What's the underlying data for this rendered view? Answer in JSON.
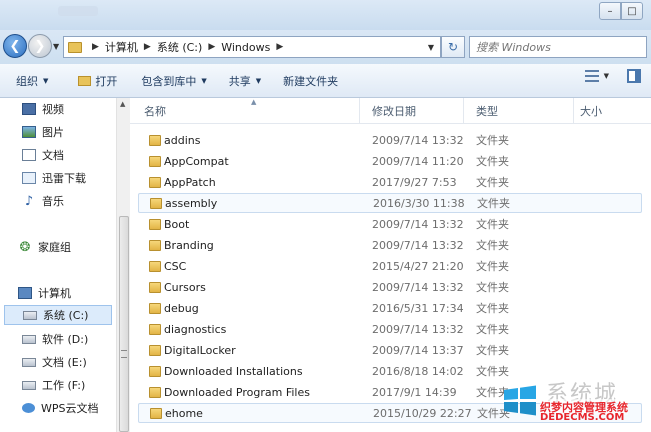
{
  "window": {
    "minimize_glyph": "–",
    "maximize_glyph": "□"
  },
  "address": {
    "breadcrumbs": [
      "计算机",
      "系统 (C:)",
      "Windows"
    ],
    "search_placeholder": "搜索 Windows"
  },
  "toolbar": {
    "organize": "组织",
    "open": "打开",
    "include_in_library": "包含到库中",
    "share": "共享",
    "new_folder": "新建文件夹"
  },
  "nav": {
    "items": [
      {
        "label": "视频",
        "icon": "video-icon"
      },
      {
        "label": "图片",
        "icon": "picture-icon"
      },
      {
        "label": "文档",
        "icon": "document-icon"
      },
      {
        "label": "迅雷下载",
        "icon": "download-folder-icon"
      },
      {
        "label": "音乐",
        "icon": "music-icon"
      },
      {
        "label": "家庭组",
        "icon": "homegroup-icon"
      },
      {
        "label": "计算机",
        "icon": "computer-icon"
      },
      {
        "label": "系统 (C:)",
        "icon": "drive-icon"
      },
      {
        "label": "软件 (D:)",
        "icon": "drive-icon"
      },
      {
        "label": "文档 (E:)",
        "icon": "drive-icon"
      },
      {
        "label": "工作 (F:)",
        "icon": "drive-icon"
      },
      {
        "label": "WPS云文档",
        "icon": "cloud-icon"
      }
    ]
  },
  "columns": {
    "name": "名称",
    "modified": "修改日期",
    "type": "类型",
    "size": "大小"
  },
  "files": [
    {
      "name": "addins",
      "date": "2009/7/14 13:32",
      "type": "文件夹"
    },
    {
      "name": "AppCompat",
      "date": "2009/7/14 11:20",
      "type": "文件夹"
    },
    {
      "name": "AppPatch",
      "date": "2017/9/27 7:53",
      "type": "文件夹"
    },
    {
      "name": "assembly",
      "date": "2016/3/30 11:38",
      "type": "文件夹"
    },
    {
      "name": "Boot",
      "date": "2009/7/14 13:32",
      "type": "文件夹"
    },
    {
      "name": "Branding",
      "date": "2009/7/14 13:32",
      "type": "文件夹"
    },
    {
      "name": "CSC",
      "date": "2015/4/27 21:20",
      "type": "文件夹"
    },
    {
      "name": "Cursors",
      "date": "2009/7/14 13:32",
      "type": "文件夹"
    },
    {
      "name": "debug",
      "date": "2016/5/31 17:34",
      "type": "文件夹"
    },
    {
      "name": "diagnostics",
      "date": "2009/7/14 13:32",
      "type": "文件夹"
    },
    {
      "name": "DigitalLocker",
      "date": "2009/7/14 13:37",
      "type": "文件夹"
    },
    {
      "name": "Downloaded Installations",
      "date": "2016/8/18 14:02",
      "type": "文件夹"
    },
    {
      "name": "Downloaded Program Files",
      "date": "2017/9/1 14:39",
      "type": "文件夹"
    },
    {
      "name": "ehome",
      "date": "2015/10/29 22:27",
      "type": "文件夹"
    }
  ],
  "watermark": {
    "big": "系统城",
    "cn": "织梦内容管理系统",
    "en": "DEDECMS.COM"
  },
  "colors": {
    "selection": "#dcebfb",
    "folder": "#e8c35a",
    "accent": "#2d6fc0"
  }
}
